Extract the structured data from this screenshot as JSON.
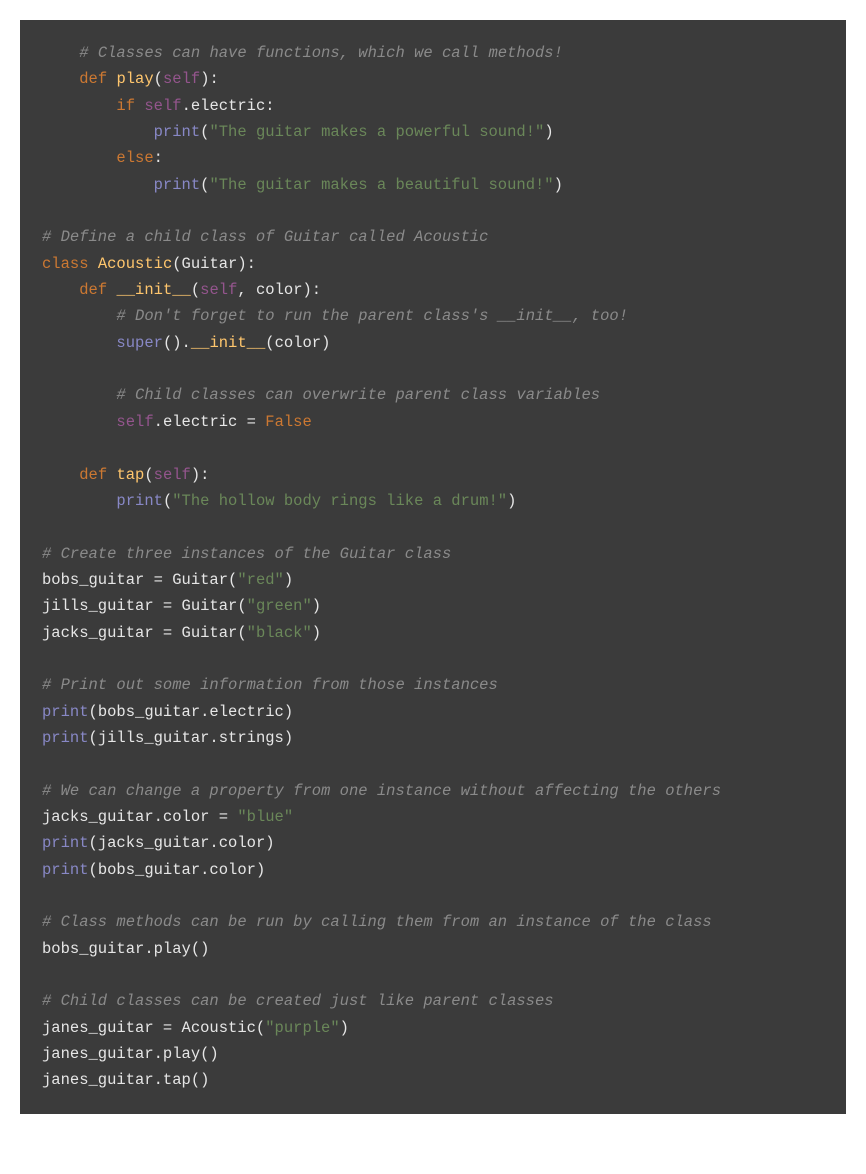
{
  "code": {
    "tokens": [
      {
        "t": "    ",
        "c": "default"
      },
      {
        "t": "# Classes can have functions, which we call methods!",
        "c": "comment"
      },
      {
        "t": "\n",
        "c": "default"
      },
      {
        "t": "    ",
        "c": "default"
      },
      {
        "t": "def",
        "c": "keyword"
      },
      {
        "t": " ",
        "c": "default"
      },
      {
        "t": "play",
        "c": "def"
      },
      {
        "t": "(",
        "c": "punct"
      },
      {
        "t": "self",
        "c": "self"
      },
      {
        "t": "):",
        "c": "punct"
      },
      {
        "t": "\n",
        "c": "default"
      },
      {
        "t": "        ",
        "c": "default"
      },
      {
        "t": "if",
        "c": "keyword"
      },
      {
        "t": " ",
        "c": "default"
      },
      {
        "t": "self",
        "c": "self"
      },
      {
        "t": ".electric:",
        "c": "default"
      },
      {
        "t": "\n",
        "c": "default"
      },
      {
        "t": "            ",
        "c": "default"
      },
      {
        "t": "print",
        "c": "builtin"
      },
      {
        "t": "(",
        "c": "punct"
      },
      {
        "t": "\"The guitar makes a powerful sound!\"",
        "c": "string"
      },
      {
        "t": ")",
        "c": "punct"
      },
      {
        "t": "\n",
        "c": "default"
      },
      {
        "t": "        ",
        "c": "default"
      },
      {
        "t": "else",
        "c": "keyword"
      },
      {
        "t": ":",
        "c": "punct"
      },
      {
        "t": "\n",
        "c": "default"
      },
      {
        "t": "            ",
        "c": "default"
      },
      {
        "t": "print",
        "c": "builtin"
      },
      {
        "t": "(",
        "c": "punct"
      },
      {
        "t": "\"The guitar makes a beautiful sound!\"",
        "c": "string"
      },
      {
        "t": ")",
        "c": "punct"
      },
      {
        "t": "\n",
        "c": "default"
      },
      {
        "t": "\n",
        "c": "default"
      },
      {
        "t": "# Define a child class of Guitar called Acoustic",
        "c": "comment"
      },
      {
        "t": "\n",
        "c": "default"
      },
      {
        "t": "class",
        "c": "keyword"
      },
      {
        "t": " ",
        "c": "default"
      },
      {
        "t": "Acoustic",
        "c": "def"
      },
      {
        "t": "(Guitar):",
        "c": "default"
      },
      {
        "t": "\n",
        "c": "default"
      },
      {
        "t": "    ",
        "c": "default"
      },
      {
        "t": "def",
        "c": "keyword"
      },
      {
        "t": " ",
        "c": "default"
      },
      {
        "t": "__init__",
        "c": "def"
      },
      {
        "t": "(",
        "c": "punct"
      },
      {
        "t": "self",
        "c": "self"
      },
      {
        "t": ", color):",
        "c": "default"
      },
      {
        "t": "\n",
        "c": "default"
      },
      {
        "t": "        ",
        "c": "default"
      },
      {
        "t": "# Don't forget to run the parent class's __init__, too!",
        "c": "comment"
      },
      {
        "t": "\n",
        "c": "default"
      },
      {
        "t": "        ",
        "c": "default"
      },
      {
        "t": "super",
        "c": "builtin"
      },
      {
        "t": "().",
        "c": "default"
      },
      {
        "t": "__init__",
        "c": "def"
      },
      {
        "t": "(color)",
        "c": "default"
      },
      {
        "t": "\n",
        "c": "default"
      },
      {
        "t": "\n",
        "c": "default"
      },
      {
        "t": "        ",
        "c": "default"
      },
      {
        "t": "# Child classes can overwrite parent class variables",
        "c": "comment"
      },
      {
        "t": "\n",
        "c": "default"
      },
      {
        "t": "        ",
        "c": "default"
      },
      {
        "t": "self",
        "c": "self"
      },
      {
        "t": ".electric = ",
        "c": "default"
      },
      {
        "t": "False",
        "c": "bool"
      },
      {
        "t": "\n",
        "c": "default"
      },
      {
        "t": "\n",
        "c": "default"
      },
      {
        "t": "    ",
        "c": "default"
      },
      {
        "t": "def",
        "c": "keyword"
      },
      {
        "t": " ",
        "c": "default"
      },
      {
        "t": "tap",
        "c": "def"
      },
      {
        "t": "(",
        "c": "punct"
      },
      {
        "t": "self",
        "c": "self"
      },
      {
        "t": "):",
        "c": "punct"
      },
      {
        "t": "\n",
        "c": "default"
      },
      {
        "t": "        ",
        "c": "default"
      },
      {
        "t": "print",
        "c": "builtin"
      },
      {
        "t": "(",
        "c": "punct"
      },
      {
        "t": "\"The hollow body rings like a drum!\"",
        "c": "string"
      },
      {
        "t": ")",
        "c": "punct"
      },
      {
        "t": "\n",
        "c": "default"
      },
      {
        "t": "\n",
        "c": "default"
      },
      {
        "t": "# Create three instances of the Guitar class",
        "c": "comment"
      },
      {
        "t": "\n",
        "c": "default"
      },
      {
        "t": "bobs_guitar = Guitar(",
        "c": "default"
      },
      {
        "t": "\"red\"",
        "c": "string"
      },
      {
        "t": ")",
        "c": "punct"
      },
      {
        "t": "\n",
        "c": "default"
      },
      {
        "t": "jills_guitar = Guitar(",
        "c": "default"
      },
      {
        "t": "\"green\"",
        "c": "string"
      },
      {
        "t": ")",
        "c": "punct"
      },
      {
        "t": "\n",
        "c": "default"
      },
      {
        "t": "jacks_guitar = Guitar(",
        "c": "default"
      },
      {
        "t": "\"black\"",
        "c": "string"
      },
      {
        "t": ")",
        "c": "punct"
      },
      {
        "t": "\n",
        "c": "default"
      },
      {
        "t": "\n",
        "c": "default"
      },
      {
        "t": "# Print out some information from those instances",
        "c": "comment"
      },
      {
        "t": "\n",
        "c": "default"
      },
      {
        "t": "print",
        "c": "builtin"
      },
      {
        "t": "(bobs_guitar.electric)",
        "c": "default"
      },
      {
        "t": "\n",
        "c": "default"
      },
      {
        "t": "print",
        "c": "builtin"
      },
      {
        "t": "(jills_guitar.strings)",
        "c": "default"
      },
      {
        "t": "\n",
        "c": "default"
      },
      {
        "t": "\n",
        "c": "default"
      },
      {
        "t": "# We can change a property from one instance without affecting the others",
        "c": "comment"
      },
      {
        "t": "\n",
        "c": "default"
      },
      {
        "t": "jacks_guitar.color = ",
        "c": "default"
      },
      {
        "t": "\"blue\"",
        "c": "string"
      },
      {
        "t": "\n",
        "c": "default"
      },
      {
        "t": "print",
        "c": "builtin"
      },
      {
        "t": "(jacks_guitar.color)",
        "c": "default"
      },
      {
        "t": "\n",
        "c": "default"
      },
      {
        "t": "print",
        "c": "builtin"
      },
      {
        "t": "(bobs_guitar.color)",
        "c": "default"
      },
      {
        "t": "\n",
        "c": "default"
      },
      {
        "t": "\n",
        "c": "default"
      },
      {
        "t": "# Class methods can be run by calling them from an instance of the class",
        "c": "comment"
      },
      {
        "t": "\n",
        "c": "default"
      },
      {
        "t": "bobs_guitar.play()",
        "c": "default"
      },
      {
        "t": "\n",
        "c": "default"
      },
      {
        "t": "\n",
        "c": "default"
      },
      {
        "t": "# Child classes can be created just like parent classes",
        "c": "comment"
      },
      {
        "t": "\n",
        "c": "default"
      },
      {
        "t": "janes_guitar = Acoustic(",
        "c": "default"
      },
      {
        "t": "\"purple\"",
        "c": "string"
      },
      {
        "t": ")",
        "c": "punct"
      },
      {
        "t": "\n",
        "c": "default"
      },
      {
        "t": "janes_guitar.play()",
        "c": "default"
      },
      {
        "t": "\n",
        "c": "default"
      },
      {
        "t": "janes_guitar.tap()",
        "c": "default"
      }
    ]
  }
}
